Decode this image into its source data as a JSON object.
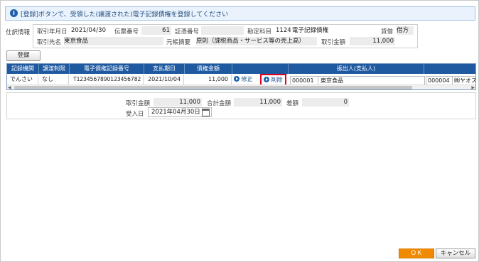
{
  "info": {
    "icon": "info-icon",
    "message": "[登録]ボタンで、受領した(譲渡された)電子記録債権を登録してください"
  },
  "journal": {
    "section_label": "仕訳情報",
    "date_label": "取引年月日",
    "date_value": "2021/04/30",
    "slip_label": "伝票番号",
    "slip_value": "61",
    "voucher_label": "証憑番号",
    "voucher_value": "",
    "account_label": "勘定科目",
    "account_code": "1124",
    "account_name": "電子記録債権",
    "side_label": "貸借",
    "side_value": "借方",
    "partner_label": "取引先名",
    "partner_value": "東京食品",
    "summary_label": "元帳摘要",
    "summary_value": "原則（課税商品・サービス等の売上高）",
    "amount_label": "取引金額",
    "amount_value": "11,000"
  },
  "toolbar": {
    "register_label": "登録"
  },
  "grid": {
    "headers": [
      "記録機関",
      "譲渡制限",
      "電子債権記録番号",
      "支払期日",
      "債権金額",
      "振出人(支払人)"
    ],
    "row": {
      "agency": "でんさい",
      "restriction": "なし",
      "record_no": "T1234567890123456782",
      "due_date": "2021/10/04",
      "amount": "11,000",
      "edit_label": "修正",
      "delete_label": "削除",
      "drawer_code": "000001",
      "drawer_name": "東京食品",
      "extra_code": "000004",
      "extra_name": "㈱ヤオス"
    }
  },
  "totals": {
    "trade_label": "取引金額",
    "trade_value": "11,000",
    "total_label": "合計金額",
    "total_value": "11,000",
    "diff_label": "差額",
    "diff_value": "0",
    "received_label": "受入日",
    "received_value": "2021年04月30日"
  },
  "footer": {
    "ok_label": "ＯＫ",
    "cancel_label": "キャンセル"
  },
  "colors": {
    "header_blue": "#1f5aa0",
    "ok_orange": "#f08a00",
    "highlight_red": "#e0001b"
  }
}
